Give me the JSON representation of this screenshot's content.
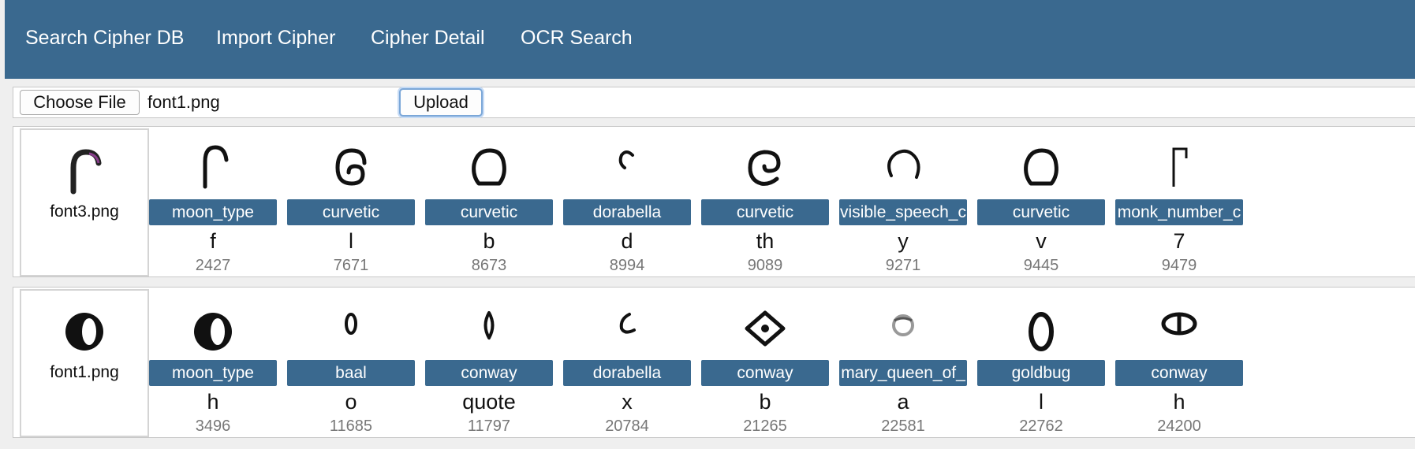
{
  "nav": {
    "items": [
      {
        "label": "Search Cipher DB"
      },
      {
        "label": "Import Cipher"
      },
      {
        "label": "Cipher Detail"
      },
      {
        "label": "OCR Search"
      }
    ]
  },
  "upload": {
    "choose_label": "Choose File",
    "file_name": "font1.png",
    "upload_label": "Upload"
  },
  "rows": [
    {
      "source": {
        "name": "font3.png",
        "icon": "hook-glyph-icon"
      },
      "matches": [
        {
          "cipher": "moon_type",
          "letter": "f",
          "id": "2427",
          "icon": "hook-glyph-icon"
        },
        {
          "cipher": "curvetic",
          "letter": "l",
          "id": "7671",
          "icon": "spiral-glyph-icon"
        },
        {
          "cipher": "curvetic",
          "letter": "b",
          "id": "8673",
          "icon": "arch-glyph-icon"
        },
        {
          "cipher": "dorabella",
          "letter": "d",
          "id": "8994",
          "icon": "small-curl-glyph-icon"
        },
        {
          "cipher": "curvetic",
          "letter": "th",
          "id": "9089",
          "icon": "curl-glyph-icon"
        },
        {
          "cipher": "visible_speech_c",
          "letter": "y",
          "id": "9271",
          "icon": "open-circle-glyph-icon"
        },
        {
          "cipher": "curvetic",
          "letter": "v",
          "id": "9445",
          "icon": "arch-glyph-icon"
        },
        {
          "cipher": "monk_number_c",
          "letter": "7",
          "id": "9479",
          "icon": "flag-glyph-icon"
        }
      ]
    },
    {
      "source": {
        "name": "font1.png",
        "icon": "crescent-circle-glyph-icon"
      },
      "matches": [
        {
          "cipher": "moon_type",
          "letter": "h",
          "id": "3496",
          "icon": "crescent-circle-glyph-icon"
        },
        {
          "cipher": "baal",
          "letter": "o",
          "id": "11685",
          "icon": "small-oval-glyph-icon"
        },
        {
          "cipher": "conway",
          "letter": "quote",
          "id": "11797",
          "icon": "lens-glyph-icon"
        },
        {
          "cipher": "dorabella",
          "letter": "x",
          "id": "20784",
          "icon": "small-c-glyph-icon"
        },
        {
          "cipher": "conway",
          "letter": "b",
          "id": "21265",
          "icon": "eye-glyph-icon"
        },
        {
          "cipher": "mary_queen_of_",
          "letter": "a",
          "id": "22581",
          "icon": "blurred-o-glyph-icon"
        },
        {
          "cipher": "goldbug",
          "letter": "l",
          "id": "22762",
          "icon": "zero-glyph-icon"
        },
        {
          "cipher": "conway",
          "letter": "h",
          "id": "24200",
          "icon": "theta-glyph-icon"
        }
      ]
    }
  ]
}
